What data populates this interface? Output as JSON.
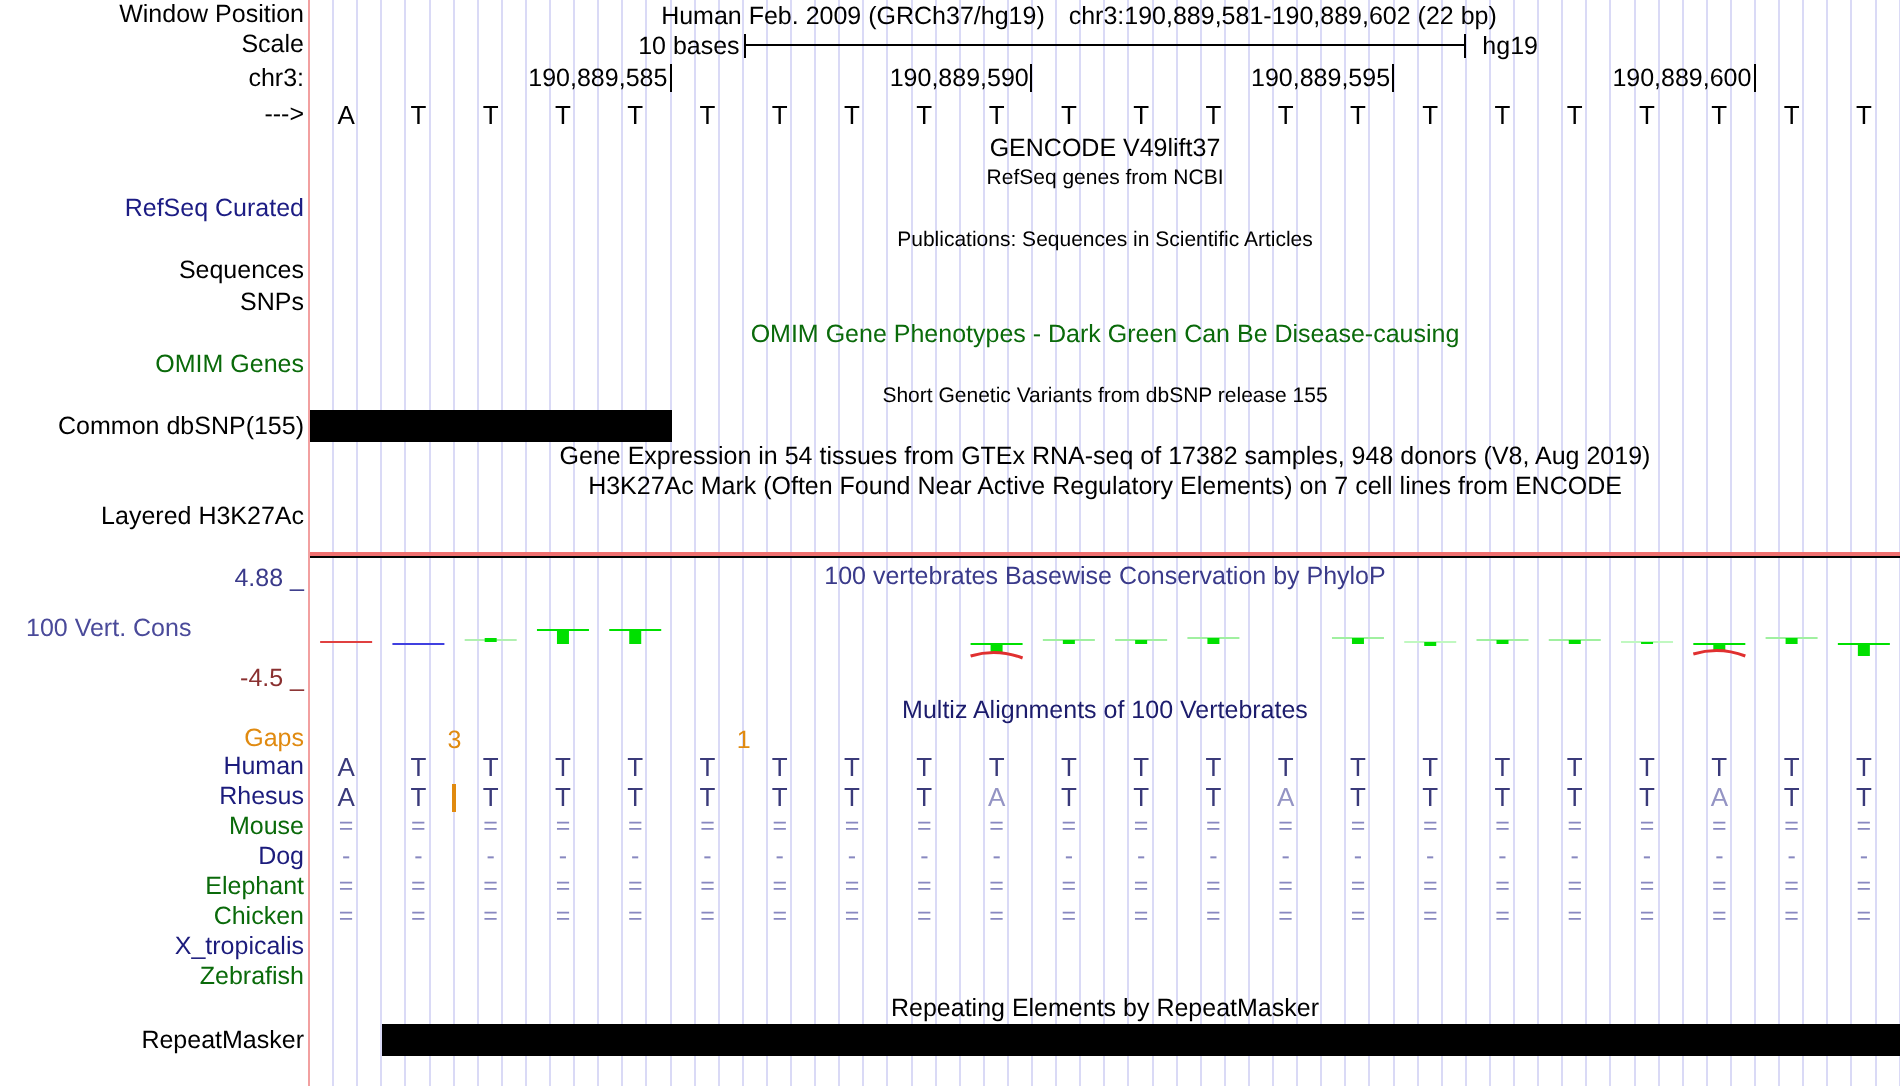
{
  "header": {
    "label": "Window Position",
    "assembly": "Human Feb. 2009 (GRCh37/hg19)",
    "range": "chr3:190,889,581-190,889,602 (22 bp)"
  },
  "scale": {
    "label": "Scale",
    "span": "10 bases",
    "assembly": "hg19"
  },
  "ruler": {
    "label": "chr3:",
    "ticks": [
      "190,889,585",
      "190,889,590",
      "190,889,595",
      "190,889,600"
    ]
  },
  "sequence": {
    "label": "--->",
    "bases": [
      "A",
      "T",
      "T",
      "T",
      "T",
      "T",
      "T",
      "T",
      "T",
      "T",
      "T",
      "T",
      "T",
      "T",
      "T",
      "T",
      "T",
      "T",
      "T",
      "T",
      "T",
      "T"
    ]
  },
  "tracks": [
    {
      "kind": "title",
      "text": "GENCODE V49lift37",
      "color": "#000000"
    },
    {
      "kind": "caption",
      "text": "RefSeq genes from NCBI"
    },
    {
      "kind": "label",
      "label": "RefSeq Curated",
      "color": "#1c1c84"
    },
    {
      "kind": "caption",
      "text": "Publications: Sequences in Scientific Articles"
    },
    {
      "kind": "label",
      "label": "Sequences",
      "color": "#000000"
    },
    {
      "kind": "label",
      "label": "SNPs",
      "color": "#000000"
    },
    {
      "kind": "title",
      "text": "OMIM Gene Phenotypes - Dark Green Can Be Disease-causing",
      "color": "#0a6a0a"
    },
    {
      "kind": "label",
      "label": "OMIM Genes",
      "color": "#0a6a0a"
    },
    {
      "kind": "caption",
      "text": "Short Genetic Variants from dbSNP release 155"
    },
    {
      "kind": "feature",
      "label": "Common dbSNP(155)"
    },
    {
      "kind": "title",
      "text": "Gene Expression in 54 tissues from GTEx RNA-seq of 17382 samples, 948 donors (V8, Aug 2019)",
      "color": "#000000"
    },
    {
      "kind": "title",
      "text": "H3K27Ac Mark (Often Found Near Active Regulatory Elements) on 7 cell lines from ENCODE",
      "color": "#000000"
    },
    {
      "kind": "label",
      "label": "Layered H3K27Ac",
      "color": "#000000"
    }
  ],
  "conservation": {
    "label": "100 Vert. Cons",
    "title": "100 vertebrates Basewise Conservation by PhyloP",
    "max": "4.88 _",
    "min": "-4.5 _"
  },
  "multiz": {
    "title": "Multiz Alignments of 100 Vertebrates",
    "gaps_label": "Gaps",
    "species": [
      {
        "name": "Human",
        "color": "#1c1c7c",
        "bases": [
          {
            "base": "A"
          },
          {
            "base": "T",
            "gap": "3"
          },
          {
            "base": "T"
          },
          {
            "base": "T"
          },
          {
            "base": "T"
          },
          {
            "base": "T",
            "gap": "1"
          },
          {
            "base": "T"
          },
          {
            "base": "T"
          },
          {
            "base": "T"
          },
          {
            "base": "T"
          },
          {
            "base": "T"
          },
          {
            "base": "T"
          },
          {
            "base": "T"
          },
          {
            "base": "T"
          },
          {
            "base": "T"
          },
          {
            "base": "T"
          },
          {
            "base": "T"
          },
          {
            "base": "T"
          },
          {
            "base": "T"
          },
          {
            "base": "T"
          },
          {
            "base": "T"
          },
          {
            "base": "T"
          }
        ]
      },
      {
        "name": "Rhesus",
        "color": "#1c1c7c",
        "bases": [
          {
            "base": "A",
            "mismatch": false,
            "insertion": false
          },
          {
            "base": "T",
            "mismatch": false,
            "insertion": true
          },
          {
            "base": "T",
            "mismatch": false,
            "insertion": false
          },
          {
            "base": "T",
            "mismatch": false,
            "insertion": false
          },
          {
            "base": "T",
            "mismatch": false,
            "insertion": false
          },
          {
            "base": "T",
            "mismatch": false,
            "insertion": false
          },
          {
            "base": "T",
            "mismatch": false,
            "insertion": false
          },
          {
            "base": "T",
            "mismatch": false,
            "insertion": false
          },
          {
            "base": "T",
            "mismatch": false,
            "insertion": false
          },
          {
            "base": "A",
            "mismatch": true,
            "insertion": false
          },
          {
            "base": "T",
            "mismatch": false,
            "insertion": false
          },
          {
            "base": "T",
            "mismatch": false,
            "insertion": false
          },
          {
            "base": "T",
            "mismatch": false,
            "insertion": false
          },
          {
            "base": "A",
            "mismatch": true,
            "insertion": false
          },
          {
            "base": "T",
            "mismatch": false,
            "insertion": false
          },
          {
            "base": "T",
            "mismatch": false,
            "insertion": false
          },
          {
            "base": "T",
            "mismatch": false,
            "insertion": false
          },
          {
            "base": "T",
            "mismatch": false,
            "insertion": false
          },
          {
            "base": "T",
            "mismatch": false,
            "insertion": false
          },
          {
            "base": "A",
            "mismatch": true,
            "insertion": false
          },
          {
            "base": "T",
            "mismatch": false,
            "insertion": false
          },
          {
            "base": "T",
            "mismatch": false,
            "insertion": false
          }
        ]
      },
      {
        "name": "Mouse",
        "color": "#0a6a0a",
        "bases": [
          "=",
          "=",
          "=",
          "=",
          "=",
          "=",
          "=",
          "=",
          "=",
          "=",
          "=",
          "=",
          "=",
          "=",
          "=",
          "=",
          "=",
          "=",
          "=",
          "=",
          "=",
          "="
        ]
      },
      {
        "name": "Dog",
        "color": "#1c1c7c",
        "bases": [
          "-",
          "-",
          "-",
          "-",
          "-",
          "-",
          "-",
          "-",
          "-",
          "-",
          "-",
          "-",
          "-",
          "-",
          "-",
          "-",
          "-",
          "-",
          "-",
          "-",
          "-",
          "-"
        ]
      },
      {
        "name": "Elephant",
        "color": "#0a6a0a",
        "bases": [
          "=",
          "=",
          "=",
          "=",
          "=",
          "=",
          "=",
          "=",
          "=",
          "=",
          "=",
          "=",
          "=",
          "=",
          "=",
          "=",
          "=",
          "=",
          "=",
          "=",
          "=",
          "="
        ]
      },
      {
        "name": "Chicken",
        "color": "#0a6a0a",
        "bases": [
          "=",
          "=",
          "=",
          "=",
          "=",
          "=",
          "=",
          "=",
          "=",
          "=",
          "=",
          "=",
          "=",
          "=",
          "=",
          "=",
          "=",
          "=",
          "=",
          "=",
          "=",
          "="
        ]
      },
      {
        "name": "X_tropicalis",
        "color": "#1c1c7c"
      },
      {
        "name": "Zebrafish",
        "color": "#0a6a0a"
      }
    ]
  },
  "repeats": {
    "title": "Repeating Elements by RepeatMasker",
    "label": "RepeatMasker"
  }
}
